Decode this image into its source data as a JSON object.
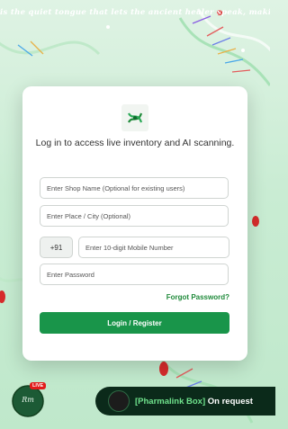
{
  "marquee": {
    "text": "is the quiet tongue that lets the ancient healer speak, making the worn"
  },
  "login": {
    "heading": "Log in to access live inventory and AI scanning.",
    "shop_name_placeholder": "Enter Shop Name (Optional for existing users)",
    "place_placeholder": "Enter Place / City (Optional)",
    "country_code": "+91",
    "mobile_placeholder": "Enter 10-digit Mobile Number",
    "password_placeholder": "Enter Password",
    "forgot_password": "Forgot Password?",
    "submit_label": "Login / Register"
  },
  "live_badge": {
    "tag": "LIVE",
    "text": "Rm"
  },
  "ticker": {
    "brand": "[Pharmalink Box]",
    "text": " On request"
  },
  "colors": {
    "primary": "#19954a",
    "link": "#1f8a3a",
    "live": "#e21b1b",
    "ticker_bg": "#0b2a1a"
  },
  "icons": {
    "logo": "pharmacy-logo-icon",
    "ticker_logo": "pharmalink-logo-icon"
  }
}
